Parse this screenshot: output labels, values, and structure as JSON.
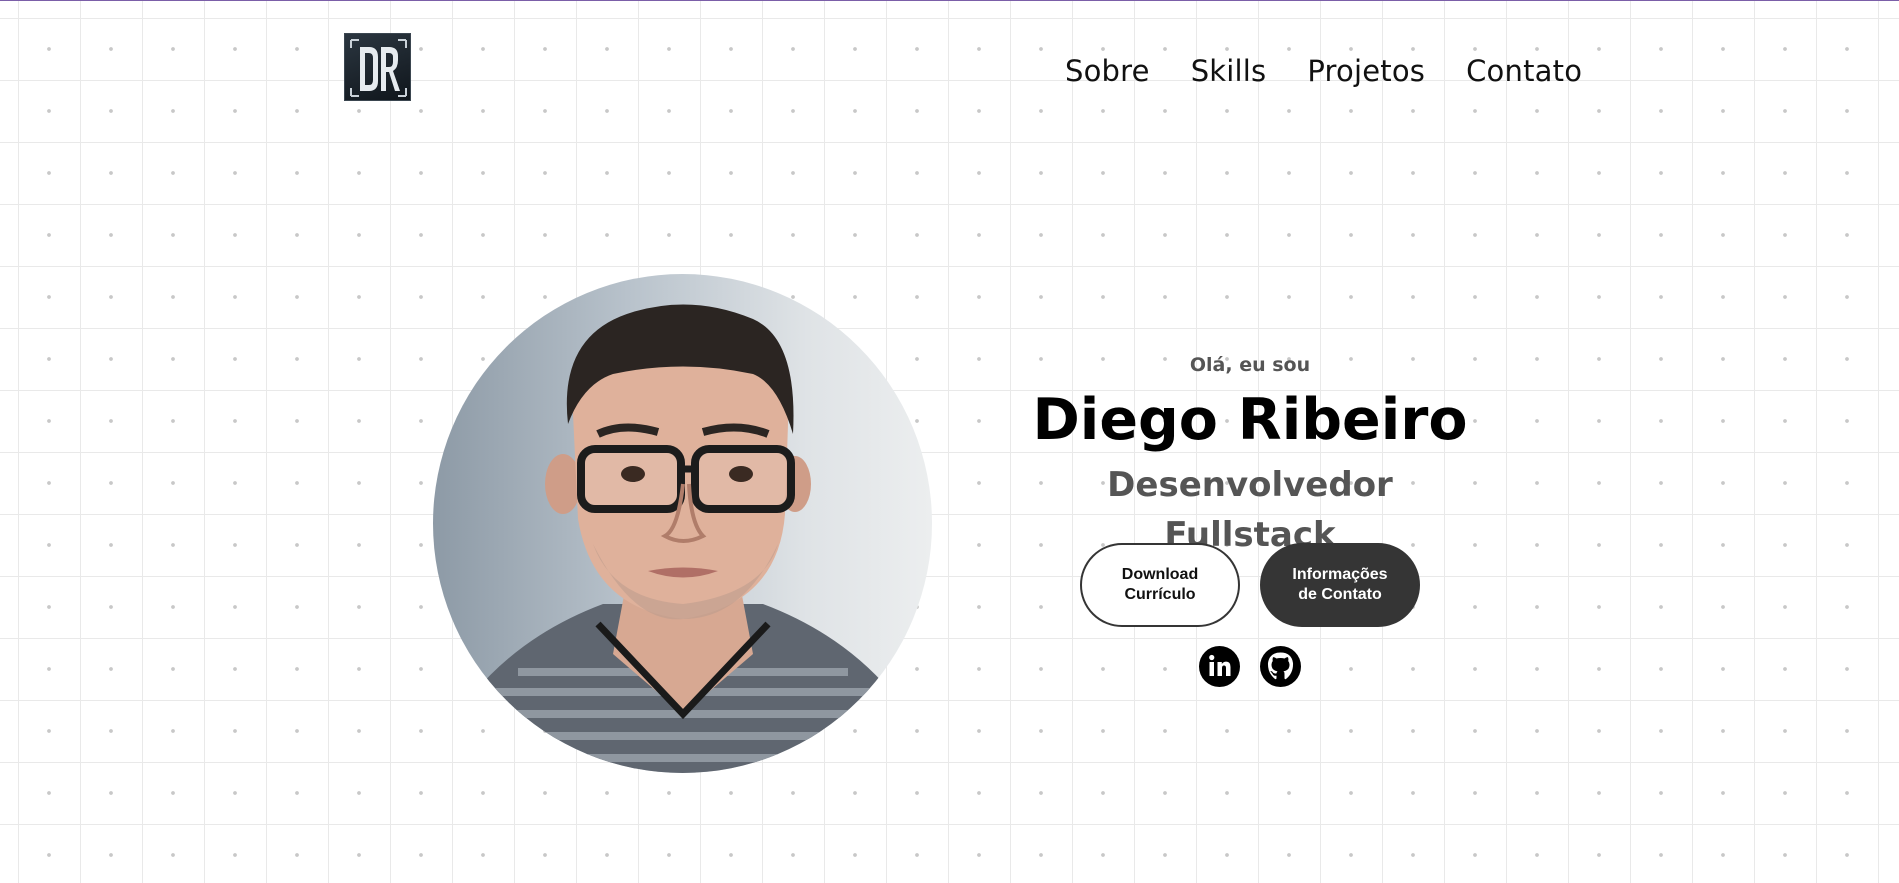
{
  "logo": {
    "text": "DR"
  },
  "nav": {
    "items": [
      {
        "label": "Sobre"
      },
      {
        "label": "Skills"
      },
      {
        "label": "Projetos"
      },
      {
        "label": "Contato"
      }
    ]
  },
  "hero": {
    "greeting": "Olá, eu sou",
    "name": "Diego Ribeiro",
    "role": "Desenvolvedor Fullstack",
    "buttons": {
      "download_label": "Download Currículo",
      "contact_label": "Informações de Contato"
    },
    "socials": [
      {
        "icon": "linkedin-icon"
      },
      {
        "icon": "github-icon"
      }
    ]
  },
  "colors": {
    "text": "#111111",
    "muted": "#555555",
    "button_dark": "#353535",
    "top_border": "#7b5fa8"
  }
}
